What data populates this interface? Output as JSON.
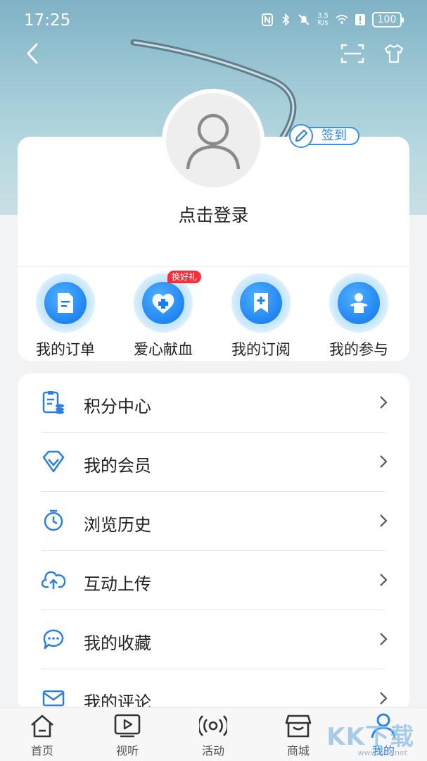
{
  "status_bar": {
    "time": "17:25",
    "net_speed_top": "3.5",
    "net_speed_bottom": "K/s",
    "battery": "100"
  },
  "profile": {
    "login_text": "点击登录",
    "signin_label": "签到"
  },
  "quick_actions": [
    {
      "label": "我的订单",
      "icon": "order-document-icon"
    },
    {
      "label": "爱心献血",
      "icon": "blood-donation-heart-icon",
      "badge": "换好礼"
    },
    {
      "label": "我的订阅",
      "icon": "bookmark-plus-icon"
    },
    {
      "label": "我的参与",
      "icon": "person-icon"
    }
  ],
  "menu": [
    {
      "label": "积分中心",
      "icon": "points-clipboard-icon"
    },
    {
      "label": "我的会员",
      "icon": "diamond-icon"
    },
    {
      "label": "浏览历史",
      "icon": "clock-icon"
    },
    {
      "label": "互动上传",
      "icon": "cloud-upload-icon"
    },
    {
      "label": "我的收藏",
      "icon": "chat-bubble-icon"
    },
    {
      "label": "我的评论",
      "icon": "mail-icon"
    }
  ],
  "tabbar": [
    {
      "label": "首页",
      "icon": "home-icon"
    },
    {
      "label": "视听",
      "icon": "video-play-icon"
    },
    {
      "label": "活动",
      "icon": "broadcast-icon"
    },
    {
      "label": "商城",
      "icon": "store-icon"
    },
    {
      "label": "我的",
      "icon": "profile-icon",
      "active": true
    }
  ],
  "colors": {
    "accent": "#1b7ff0",
    "badge": "#f5303a"
  },
  "watermark": {
    "main": "KK下载",
    "sub": "www.kkx.net"
  }
}
